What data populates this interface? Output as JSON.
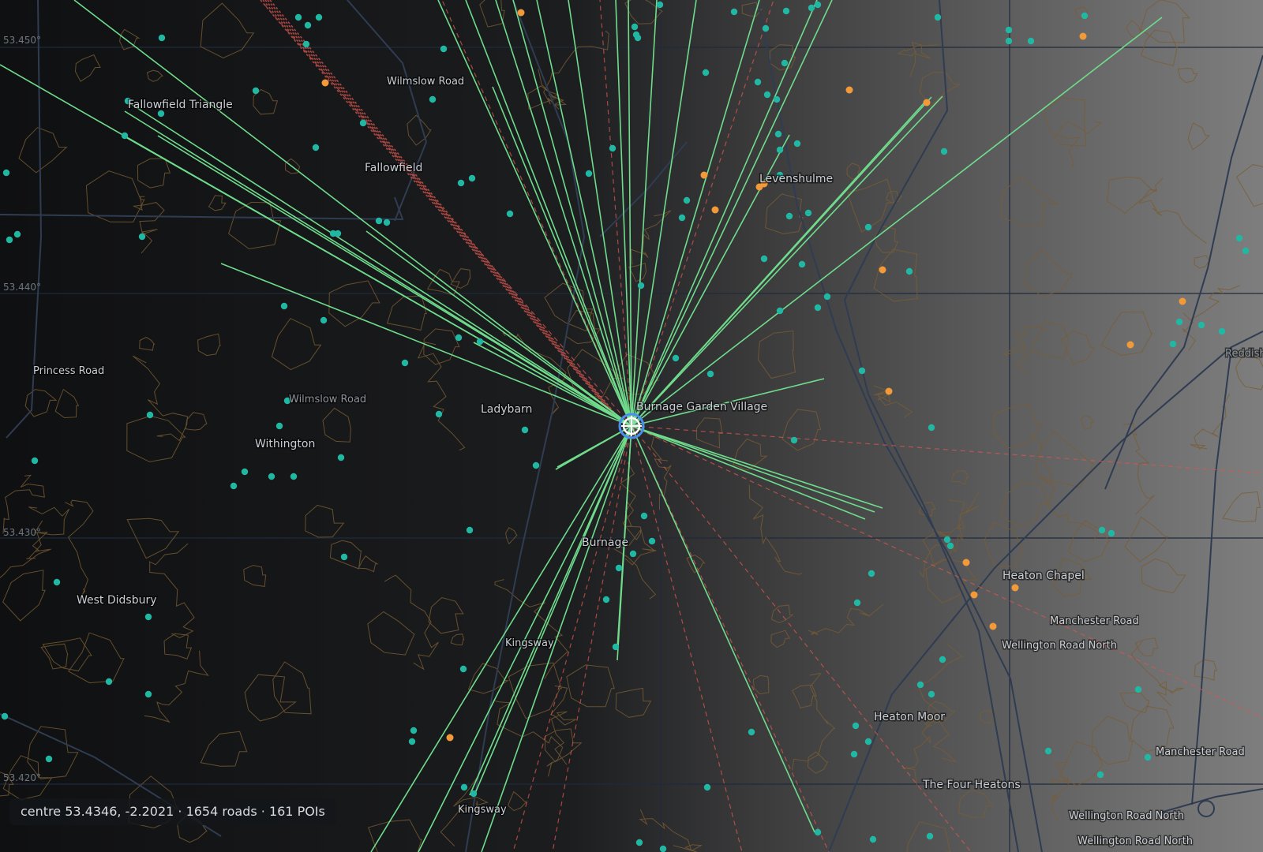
{
  "status": {
    "text": "centre 53.4346, -2.2021 · 1654 roads · 161 POIs"
  },
  "centre": {
    "lat": 53.4346,
    "lon": -2.2021
  },
  "counts": {
    "roads": 1654,
    "pois": 161
  },
  "colors": {
    "background_dark": "#0e0f11",
    "background_light": "#7b7b7b",
    "connection_line": "#6ee28f",
    "dashed_line": "#e05a5a",
    "poi_teal": "#21b7a3",
    "poi_orange": "#f2993a",
    "contour": "#8a6a3a",
    "grid": "#1e2a3a",
    "road": "#2e3a4c",
    "centre_marker": "#4a8ef0"
  },
  "latitude_labels": [
    "53.450°",
    "53.440°",
    "53.430°",
    "53.420°"
  ],
  "place_labels": [
    "Fallowfield Triangle",
    "Wilmslow Road",
    "Fallowfield",
    "Levenshulme",
    "Princess Road",
    "Wilmslow Road",
    "Ladybarn",
    "Burnage Garden Village",
    "Withington",
    "Burnage",
    "West Didsbury",
    "Heaton Chapel",
    "Manchester Road",
    "Wellington Road North",
    "Kingsway",
    "Heaton Moor",
    "The Four Heatons",
    "Manchester Road",
    "Kingsway",
    "Wellington Road North",
    "Wellington Road North",
    "Reddish"
  ],
  "icons": {
    "centre": "crosshair-target-icon"
  }
}
